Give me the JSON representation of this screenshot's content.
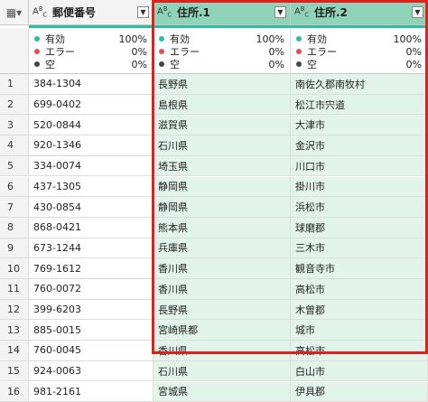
{
  "columns": [
    {
      "type_icon": "ABC",
      "name": "郵便番号"
    },
    {
      "type_icon": "ABC",
      "name": "住所.1"
    },
    {
      "type_icon": "ABC",
      "name": "住所.2"
    }
  ],
  "quality": {
    "labels": [
      "有効",
      "エラー",
      "空"
    ],
    "colors": [
      "#2bbf9b",
      "#e05050",
      "#444444"
    ],
    "col1": [
      "100%",
      "0%",
      "0%"
    ],
    "col2": [
      "100%",
      "0%",
      "0%"
    ],
    "col3": [
      "100%",
      "0%",
      "0%"
    ]
  },
  "rows": [
    [
      "1",
      "384-1304",
      "長野県",
      "南佐久郡南牧村"
    ],
    [
      "2",
      "699-0402",
      "島根県",
      "松江市宍道"
    ],
    [
      "3",
      "520-0844",
      "滋賀県",
      "大津市"
    ],
    [
      "4",
      "920-1346",
      "石川県",
      "金沢市"
    ],
    [
      "5",
      "334-0074",
      "埼玉県",
      "川口市"
    ],
    [
      "6",
      "437-1305",
      "静岡県",
      "掛川市"
    ],
    [
      "7",
      "430-0854",
      "静岡県",
      "浜松市"
    ],
    [
      "8",
      "868-0421",
      "熊本県",
      "球磨郡"
    ],
    [
      "9",
      "673-1244",
      "兵庫県",
      "三木市"
    ],
    [
      "10",
      "769-1612",
      "香川県",
      "観音寺市"
    ],
    [
      "11",
      "760-0072",
      "香川県",
      "高松市"
    ],
    [
      "12",
      "399-6203",
      "長野県",
      "木曽郡"
    ],
    [
      "13",
      "885-0015",
      "宮崎県都",
      "城市"
    ],
    [
      "14",
      "760-0045",
      "香川県",
      "高松市"
    ],
    [
      "15",
      "924-0063",
      "石川県",
      "白山市"
    ],
    [
      "16",
      "981-2161",
      "宮城県",
      "伊具郡"
    ]
  ]
}
